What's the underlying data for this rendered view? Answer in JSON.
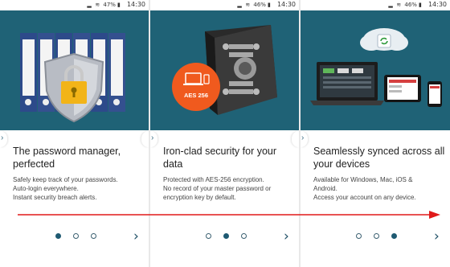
{
  "status_bar": {
    "battery": [
      "47%",
      "46%",
      "46%"
    ],
    "time": [
      "14:30",
      "14:30",
      "14:30"
    ]
  },
  "screens": [
    {
      "title": "The password manager, perfected",
      "body": [
        "Safely keep track of your passwords.",
        "Auto-login everywhere.",
        "Instant security breach alerts."
      ],
      "active_dot": 0
    },
    {
      "title": "Iron-clad security for your data",
      "body": [
        "Protected with AES-256 encryption.",
        "No record of your master password or",
        "encryption key by default."
      ],
      "badge": "AES 256",
      "active_dot": 1
    },
    {
      "title": "Seamlessly synced across all your devices",
      "body": [
        "Available for Windows, Mac, iOS &",
        "Android.",
        "Access your account on any device."
      ],
      "active_dot": 2
    }
  ],
  "colors": {
    "hero_bg": "#1f6276",
    "accent": "#1f5a72",
    "swipe_arrow": "#e01a1a"
  }
}
